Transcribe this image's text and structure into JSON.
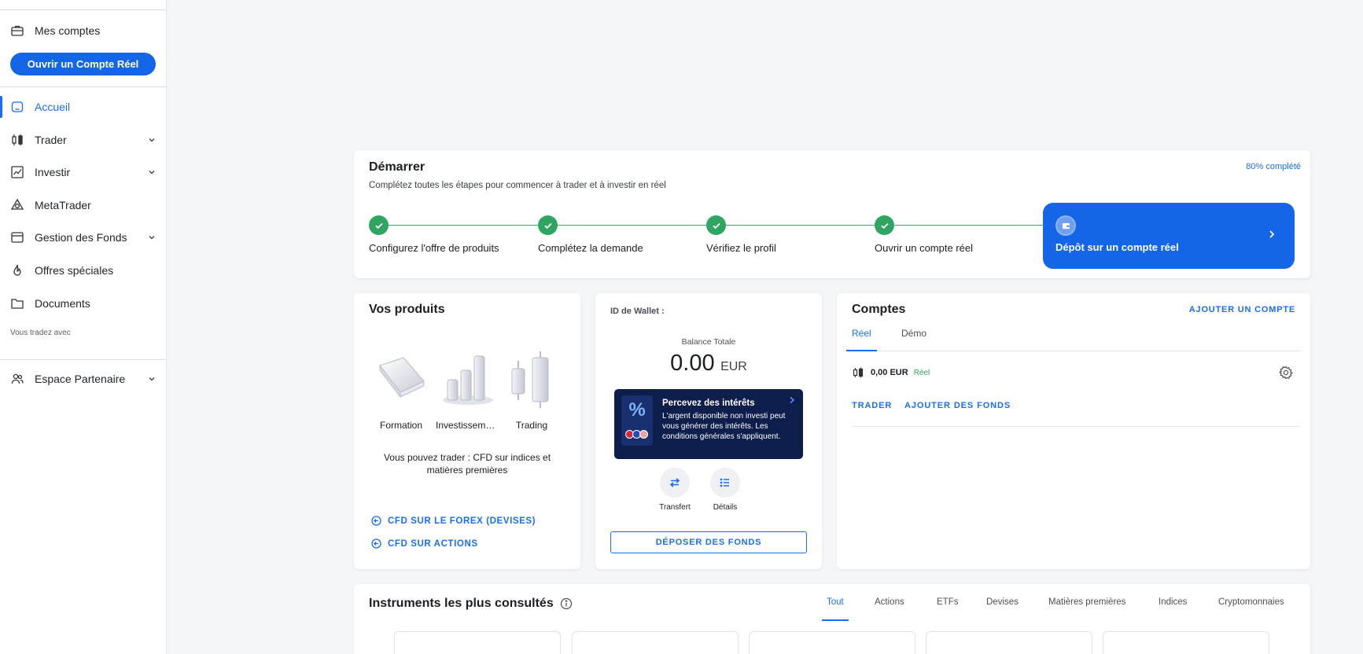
{
  "sidebar": {
    "my_accounts": "Mes comptes",
    "open_real_account": "Ouvrir un Compte Réel",
    "items": [
      {
        "label": "Accueil"
      },
      {
        "label": "Trader"
      },
      {
        "label": "Investir"
      },
      {
        "label": "MetaTrader"
      },
      {
        "label": "Gestion des Fonds"
      },
      {
        "label": "Offres spéciales"
      },
      {
        "label": "Documents"
      }
    ],
    "trading_with": "Vous tradez avec",
    "partner": "Espace Partenaire"
  },
  "start": {
    "title": "Démarrer",
    "subtitle": "Complétez toutes les étapes pour commencer à trader et à investir en réel",
    "progress": "80% complété",
    "steps": [
      {
        "label": "Configurez l'offre de produits"
      },
      {
        "label": "Complétez la demande"
      },
      {
        "label": "Vérifiez le profil"
      },
      {
        "label": "Ouvrir un compte réel"
      }
    ],
    "active_step": "Dépôt sur un compte réel"
  },
  "products": {
    "title": "Vos produits",
    "items": [
      {
        "label": "Formation"
      },
      {
        "label": "Investisseme..."
      },
      {
        "label": "Trading"
      }
    ],
    "info": "Vous pouvez trader : CFD sur indices et matières premières",
    "links": [
      "CFD SUR LE FOREX (DEVISES)",
      "CFD SUR ACTIONS"
    ]
  },
  "wallet": {
    "id_label": "ID de Wallet :",
    "balance_label": "Balance Totale",
    "balance": "0.00",
    "currency": "EUR",
    "promo": {
      "title": "Percevez des intérêts",
      "text": "L'argent disponible non investi peut vous générer des intérêts. Les conditions générales s'appliquent."
    },
    "actions": [
      {
        "label": "Transfert"
      },
      {
        "label": "Détails"
      }
    ],
    "deposit": "DÉPOSER DES FONDS"
  },
  "accounts": {
    "title": "Comptes",
    "add": "AJOUTER UN COMPTE",
    "tabs": [
      "Réel",
      "Démo"
    ],
    "row": {
      "amount": "0,00 EUR",
      "type": "Réel"
    },
    "links": [
      "TRADER",
      "AJOUTER DES FONDS"
    ]
  },
  "instruments": {
    "title": "Instruments les plus consultés",
    "tabs": [
      "Tout",
      "Actions",
      "ETFs",
      "Devises",
      "Matières premières",
      "Indices",
      "Cryptomonnaies"
    ]
  },
  "colors": {
    "accent": "#1565e8",
    "success": "#2fa561",
    "promo_bg": "#0d1e4d"
  }
}
